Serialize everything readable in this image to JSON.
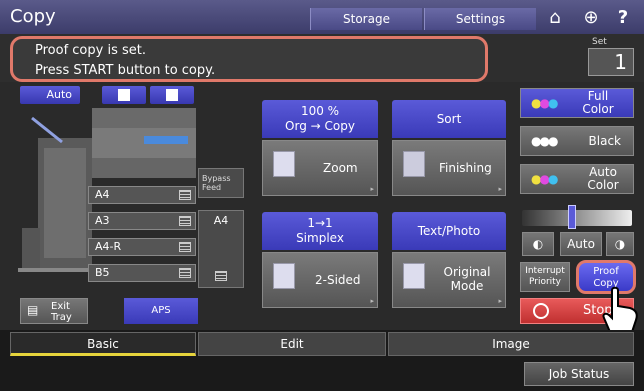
{
  "header": {
    "title": "Copy",
    "storage_label": "Storage",
    "settings_label": "Settings"
  },
  "message": {
    "line1": "Proof copy is set.",
    "line2": "Press START button to copy."
  },
  "set_counter": {
    "label": "Set",
    "value": "1"
  },
  "paper_source": {
    "auto_label": "Auto",
    "trays": [
      "A4",
      "A3",
      "A4-R",
      "B5"
    ],
    "bypass_label": "Bypass Feed",
    "bypass_size": "A4",
    "exit_tray_label": "Exit Tray",
    "aps_label": "APS"
  },
  "functions": {
    "zoom_ratio": "100 %",
    "zoom_sub": "Org  →  Copy",
    "zoom_label": "Zoom",
    "sort_label": "Sort",
    "finishing_label": "Finishing",
    "duplex_mode": "1→1",
    "duplex_sub": "Simplex",
    "twosided_label": "2-Sided",
    "image_mode": "Text/Photo",
    "original_mode_label": "Original Mode"
  },
  "color": {
    "full_color": "Full Color",
    "black": "Black",
    "auto_color": "Auto Color"
  },
  "exposure": {
    "auto_label": "Auto",
    "level": 0.45
  },
  "actions": {
    "interrupt_label": "Interrupt Priority",
    "proof_copy_label": "Proof Copy",
    "stop_label": "Stop"
  },
  "tabs": [
    {
      "label": "Basic"
    },
    {
      "label": "Edit"
    },
    {
      "label": "Image"
    }
  ],
  "job_status_label": "Job Status",
  "colors": {
    "accent": "#e0796a",
    "tab_active": "#e6d43c",
    "blue": "#4a4ac8"
  }
}
